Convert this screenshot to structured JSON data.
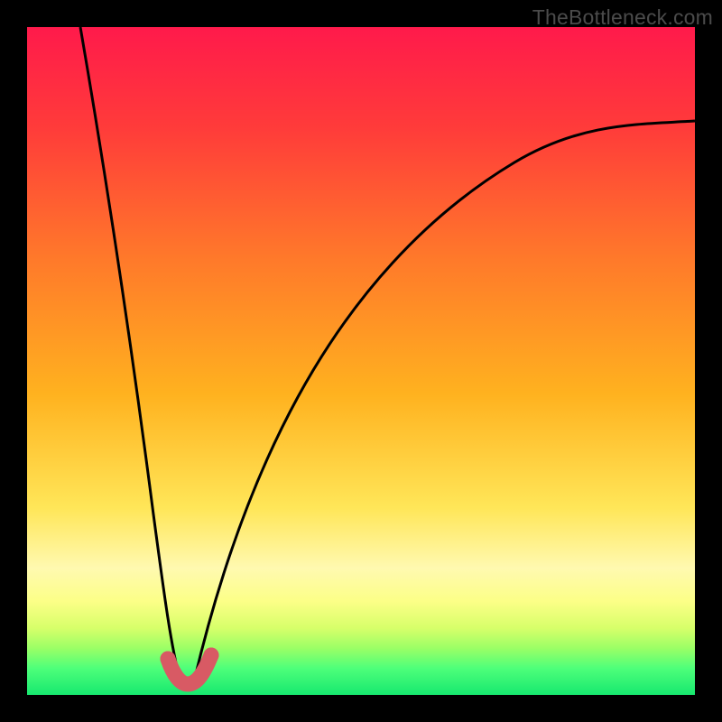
{
  "watermark": "TheBottleneck.com",
  "chart_data": {
    "type": "line",
    "title": "",
    "xlabel": "",
    "ylabel": "",
    "xlim": [
      0,
      100
    ],
    "ylim": [
      0,
      100
    ],
    "background_gradient_stops": [
      {
        "pct": 0,
        "color": "#ff1a4b"
      },
      {
        "pct": 15,
        "color": "#ff3b3a"
      },
      {
        "pct": 35,
        "color": "#ff7a2a"
      },
      {
        "pct": 55,
        "color": "#ffb21f"
      },
      {
        "pct": 72,
        "color": "#ffe658"
      },
      {
        "pct": 81,
        "color": "#fff9b0"
      },
      {
        "pct": 86,
        "color": "#fcff87"
      },
      {
        "pct": 90,
        "color": "#d7ff6a"
      },
      {
        "pct": 93,
        "color": "#9bff66"
      },
      {
        "pct": 96,
        "color": "#4eff7a"
      },
      {
        "pct": 100,
        "color": "#17e86f"
      }
    ],
    "series": [
      {
        "name": "left-branch",
        "note": "Descending curve from top-left toward the minimum near x≈22",
        "x": [
          8,
          10,
          12,
          14,
          16,
          18,
          20,
          21,
          22,
          23
        ],
        "y": [
          100,
          86,
          72,
          58,
          44,
          29,
          14,
          7,
          3,
          2
        ]
      },
      {
        "name": "right-branch",
        "note": "Rising curve from the minimum toward far right",
        "x": [
          25,
          27,
          30,
          34,
          38,
          44,
          50,
          58,
          66,
          76,
          88,
          100
        ],
        "y": [
          2,
          8,
          18,
          30,
          40,
          50,
          58,
          65,
          71,
          77,
          82,
          86
        ]
      },
      {
        "name": "bottom-highlight",
        "note": "Thick red/pink U-shaped highlight segment at the curve minimum",
        "color": "#d85a64",
        "x": [
          21.0,
          21.8,
          22.6,
          23.4,
          24.3,
          25.2,
          26.0,
          26.9,
          27.6
        ],
        "y": [
          5.2,
          3.3,
          2.3,
          1.9,
          1.9,
          2.3,
          3.1,
          4.5,
          6.0
        ]
      }
    ],
    "minimum": {
      "x": 23.5,
      "y": 1.9
    }
  }
}
